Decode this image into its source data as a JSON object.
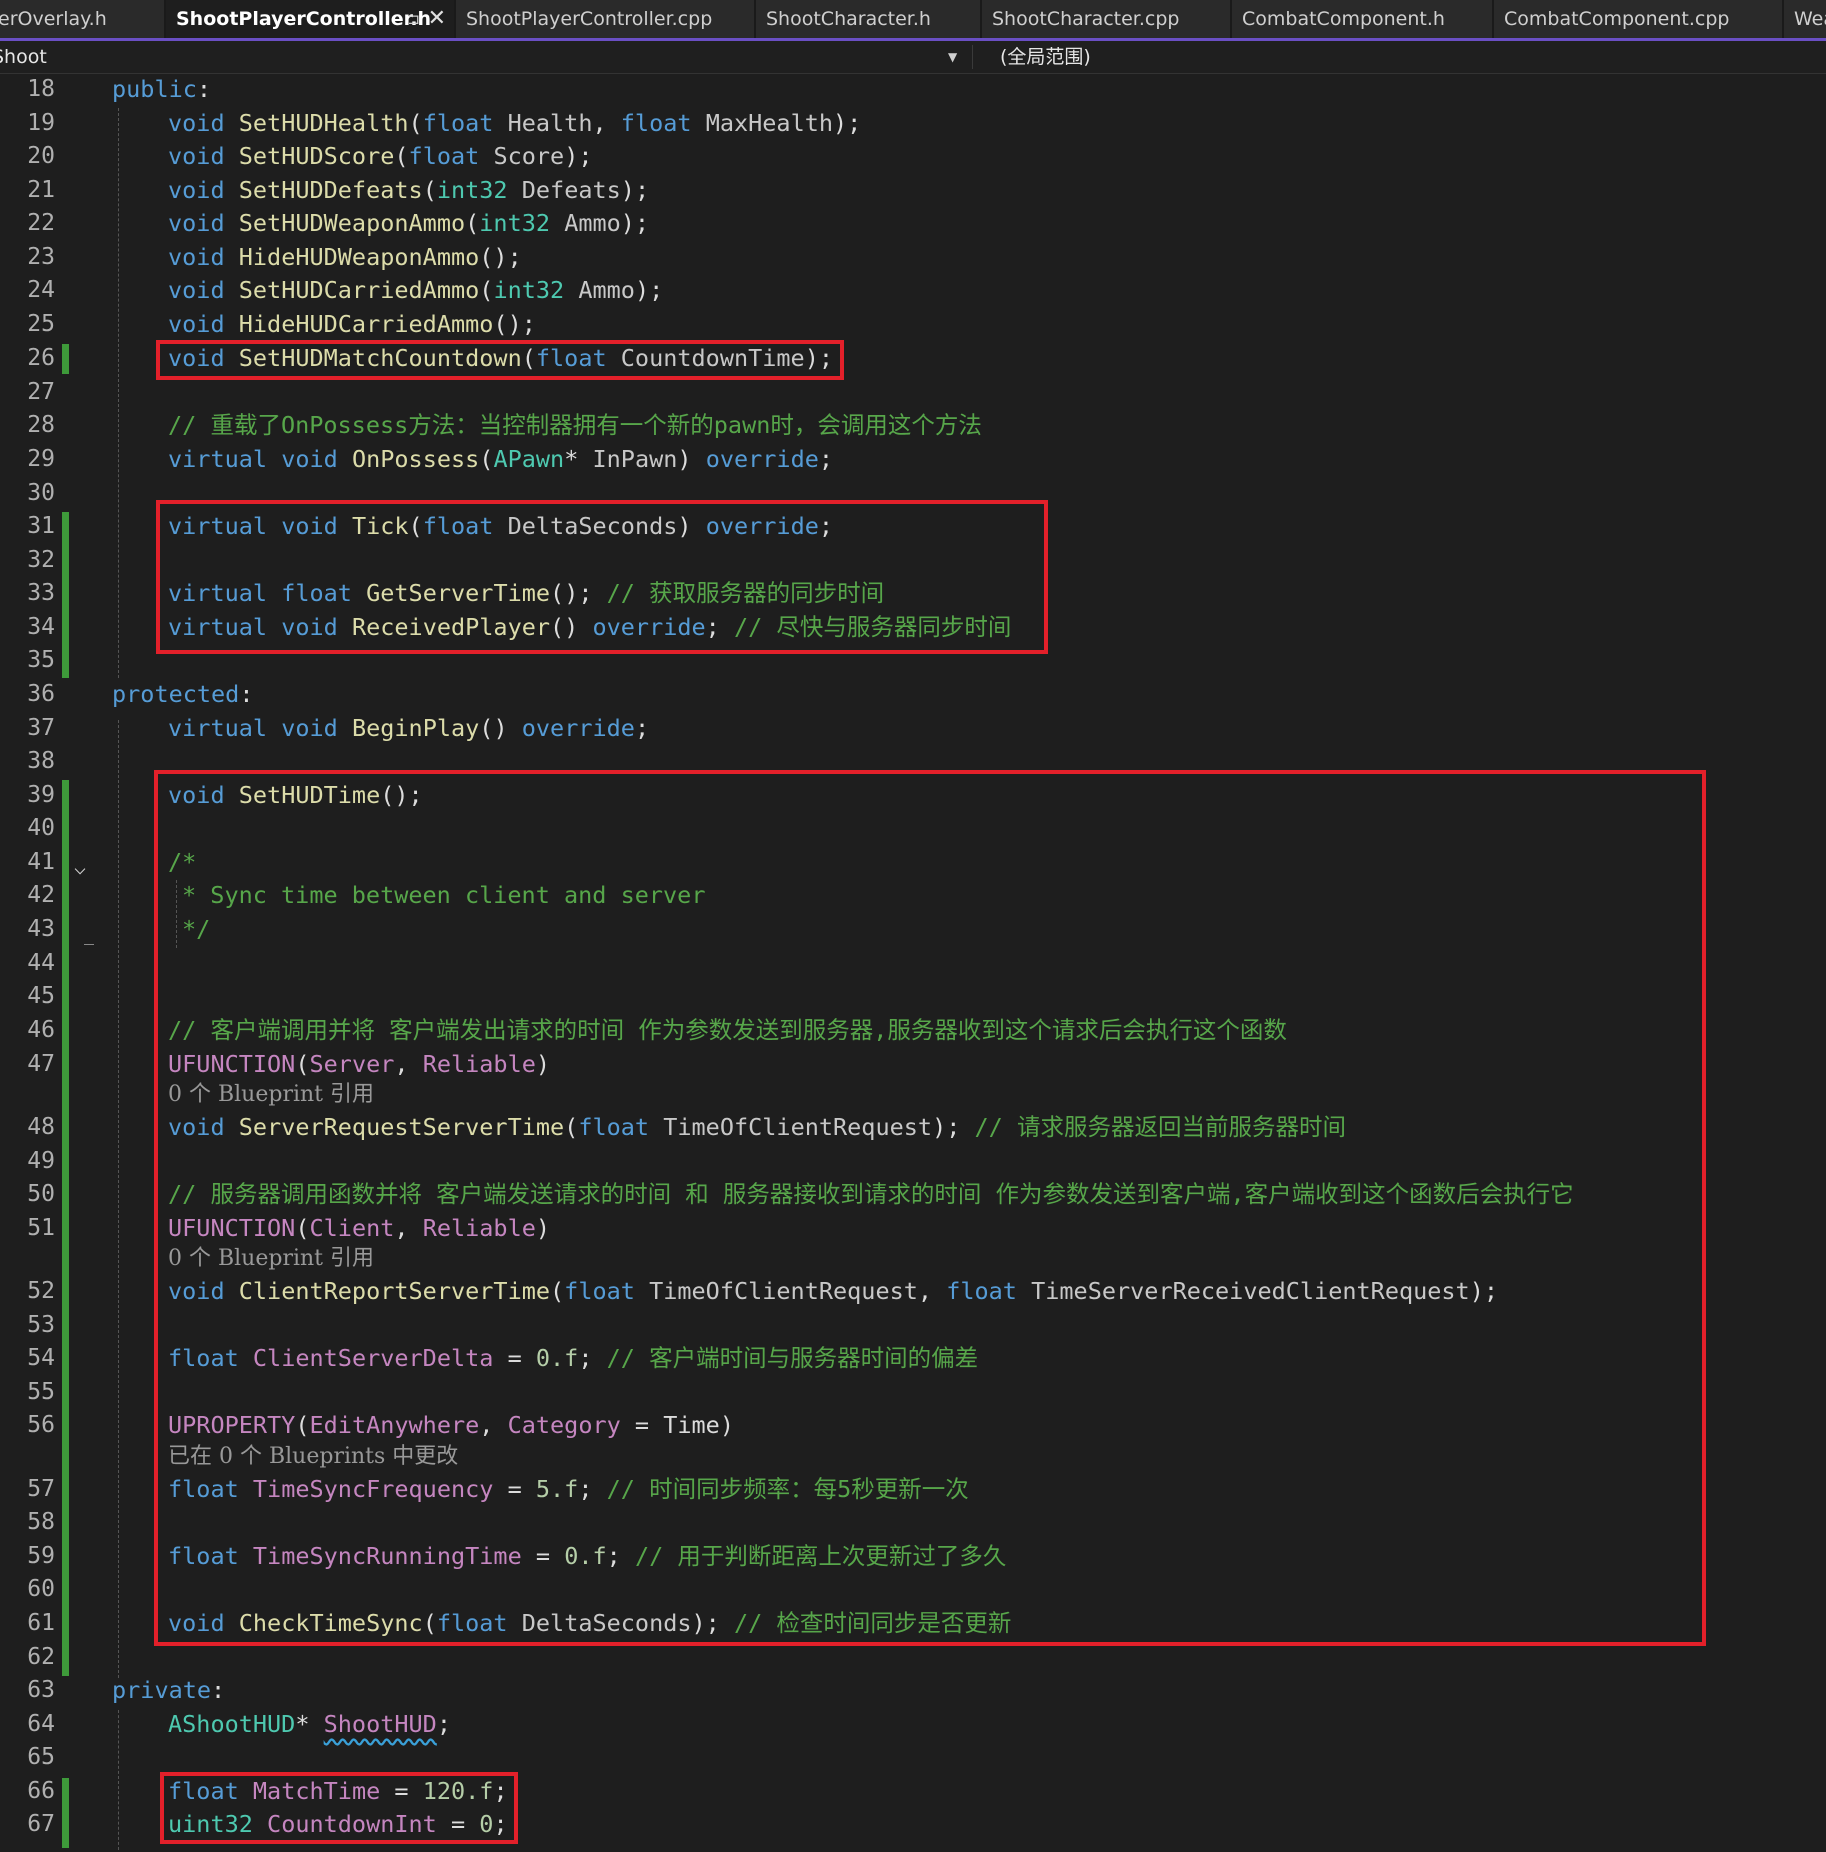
{
  "tabs": [
    {
      "label": "erOverlay.h"
    },
    {
      "label": "ShootPlayerController.h",
      "active": true,
      "pin": "⊐",
      "close": "✕"
    },
    {
      "label": "ShootPlayerController.cpp"
    },
    {
      "label": "ShootCharacter.h"
    },
    {
      "label": "ShootCharacter.cpp"
    },
    {
      "label": "CombatComponent.h"
    },
    {
      "label": "CombatComponent.cpp"
    },
    {
      "label": "Wea"
    }
  ],
  "navbar": {
    "project": "Shoot",
    "scope": "(全局范围)"
  },
  "colors": {
    "keyword": "#569cd6",
    "type": "#4ec9b0",
    "function": "#dcdcaa",
    "comment": "#57a64a",
    "macro": "#c586c0",
    "highlight_box": "#e3202a",
    "change_bar": "#3e9a3a"
  },
  "line_numbers": [
    "18",
    "19",
    "20",
    "21",
    "22",
    "23",
    "24",
    "25",
    "26",
    "27",
    "28",
    "29",
    "30",
    "31",
    "32",
    "33",
    "34",
    "35",
    "36",
    "37",
    "38",
    "39",
    "40",
    "41",
    "42",
    "43",
    "44",
    "45",
    "46",
    "47",
    "48",
    "49",
    "50",
    "51",
    "52",
    "53",
    "54",
    "55",
    "56",
    "57",
    "58",
    "59",
    "60",
    "61",
    "62",
    "63",
    "64",
    "65",
    "66",
    "67"
  ],
  "code": {
    "l18_kw": "public",
    "l18_p": ":",
    "void": "void",
    "float": "float",
    "int32": "int32",
    "virtual": "virtual",
    "override": "override",
    "l19_fn": "SetHUDHealth",
    "l19_a": "Health",
    "l19_b": "MaxHealth",
    "l20_fn": "SetHUDScore",
    "l20_a": "Score",
    "l21_fn": "SetHUDDefeats",
    "l21_a": "Defeats",
    "l22_fn": "SetHUDWeaponAmmo",
    "l22_a": "Ammo",
    "l23_fn": "HideHUDWeaponAmmo",
    "l24_fn": "SetHUDCarriedAmmo",
    "l24_a": "Ammo",
    "l25_fn": "HideHUDCarriedAmmo",
    "l26_fn": "SetHUDMatchCountdown",
    "l26_a": "CountdownTime",
    "l28_cm": "// 重载了OnPossess方法：当控制器拥有一个新的pawn时，会调用这个方法",
    "l29_fn": "OnPossess",
    "l29_ty": "APawn",
    "l29_a": "InPawn",
    "l31_fn": "Tick",
    "l31_a": "DeltaSeconds",
    "l33_fn": "GetServerTime",
    "l33_cm": "// 获取服务器的同步时间",
    "l34_fn": "ReceivedPlayer",
    "l34_cm": "// 尽快与服务器同步时间",
    "l36_kw": "protected",
    "l37_fn": "BeginPlay",
    "l39_fn": "SetHUDTime",
    "l41_cm": "/*",
    "l42_cm": "* Sync time between client and server",
    "l43_cm": "*/",
    "l46_cm": "// 客户端调用并将 客户端发出请求的时间 作为参数发送到服务器,服务器收到这个请求后会执行这个函数",
    "ufunction": "UFUNCTION",
    "server": "Server",
    "reliable": "Reliable",
    "client": "Client",
    "bp_refs": "0 个 Blueprint 引用",
    "l48_fn": "ServerRequestServerTime",
    "l48_a": "TimeOfClientRequest",
    "l48_cm": "// 请求服务器返回当前服务器时间",
    "l50_cm": "// 服务器调用函数并将 客户端发送请求的时间 和 服务器接收到请求的时间 作为参数发送到客户端,客户端收到这个函数后会执行它",
    "l52_fn": "ClientReportServerTime",
    "l52_a": "TimeOfClientRequest",
    "l52_b": "TimeServerReceivedClientRequest",
    "l54_var": "ClientServerDelta",
    "l54_num": "0.f",
    "l54_cm": "// 客户端时间与服务器时间的偏差",
    "uproperty": "UPROPERTY",
    "editanywhere": "EditAnywhere",
    "category": "Category",
    "time": "Time",
    "bp_changed": "已在 0 个 Blueprints 中更改",
    "l57_var": "TimeSyncFrequency",
    "l57_num": "5.f",
    "l57_cm": "// 时间同步频率：每5秒更新一次",
    "l59_var": "TimeSyncRunningTime",
    "l59_num": "0.f",
    "l59_cm": "// 用于判断距离上次更新过了多久",
    "l61_fn": "CheckTimeSync",
    "l61_a": "DeltaSeconds",
    "l61_cm": "// 检查时间同步是否更新",
    "l63_kw": "private",
    "l64_ty": "AShootHUD",
    "l64_var": "ShootHUD",
    "uint32": "uint32",
    "l66_var": "MatchTime",
    "l66_num": "120.f",
    "l67_var": "CountdownInt",
    "l67_num": "0"
  }
}
